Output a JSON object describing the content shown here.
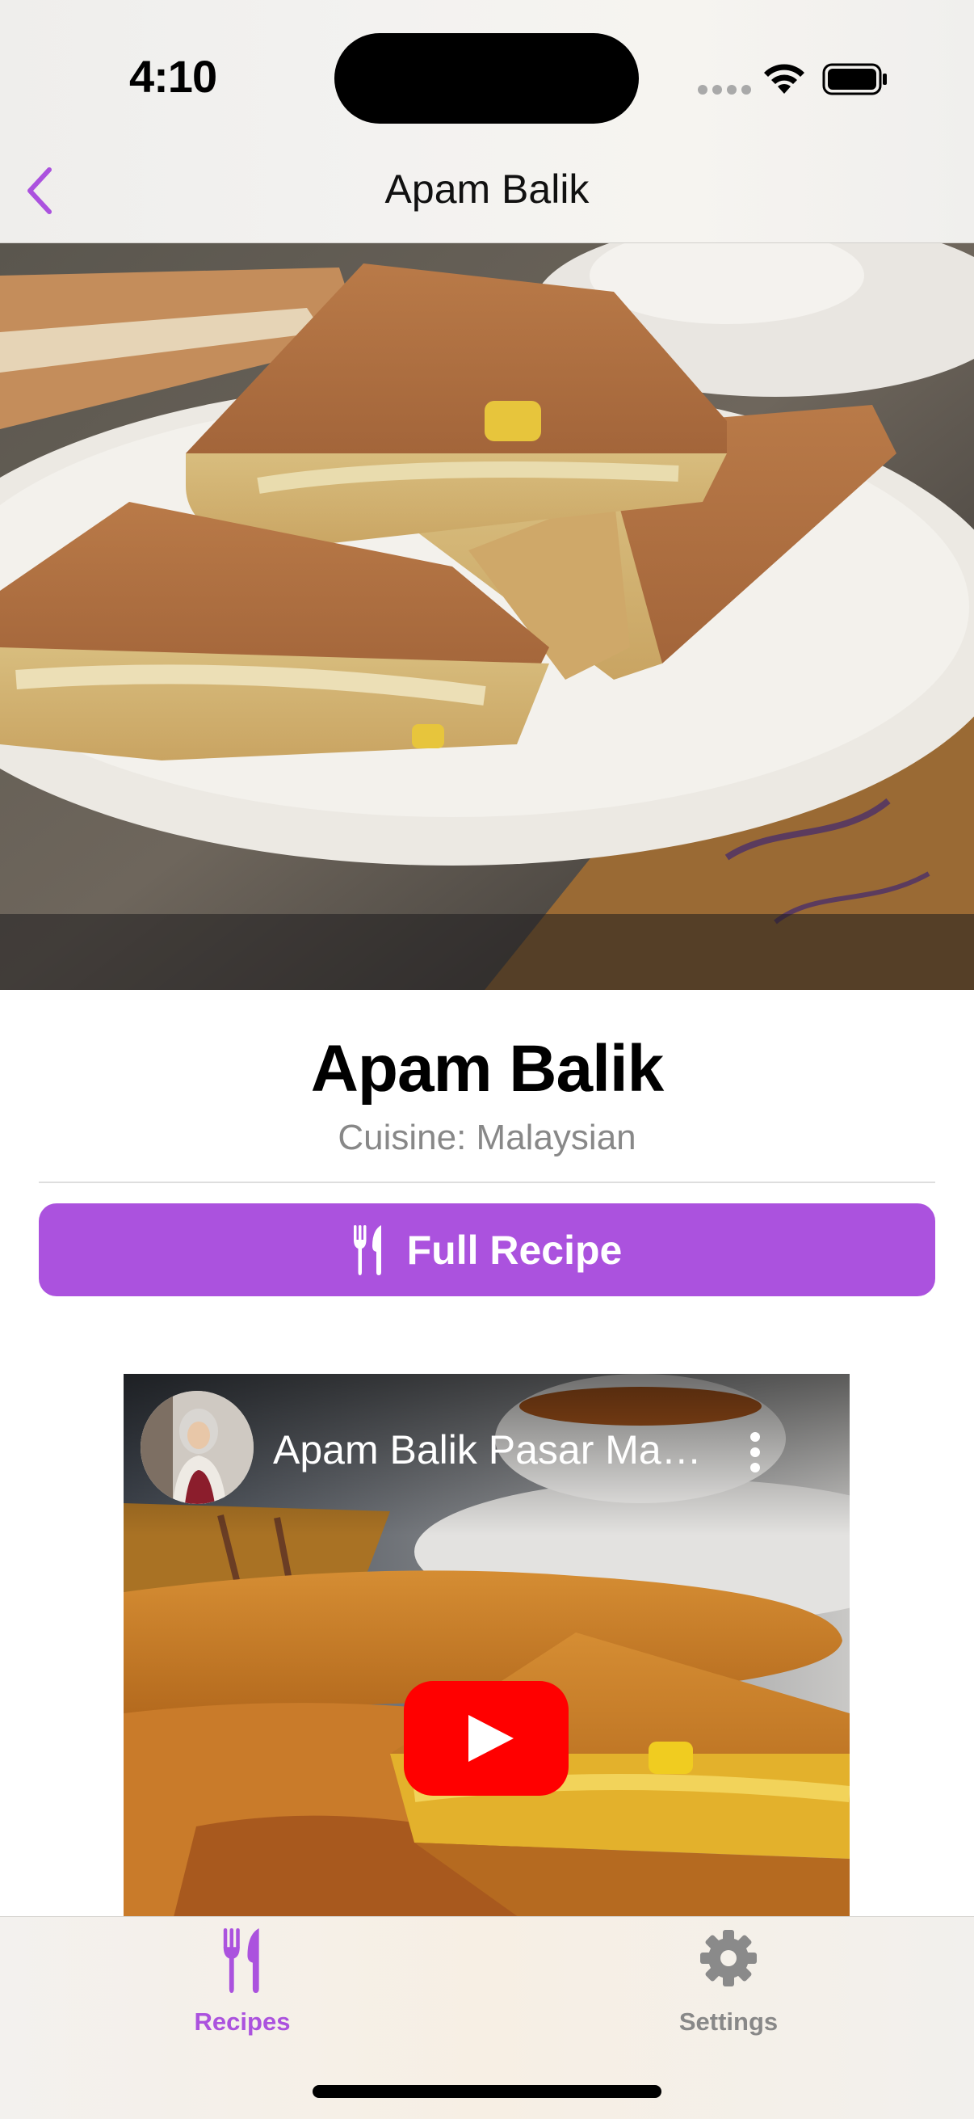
{
  "status_bar": {
    "time": "4:10"
  },
  "nav": {
    "back_icon": "chevron-left-icon",
    "title": "Apam Balik"
  },
  "recipe": {
    "name": "Apam Balik",
    "cuisine": "Cuisine: Malaysian",
    "full_recipe_label": "Full Recipe",
    "full_recipe_icon": "fork-knife-icon"
  },
  "video": {
    "title": "Apam Balik Pasar Malam",
    "more_icon": "more-vertical-icon",
    "play_icon": "youtube-play-icon"
  },
  "tabs": [
    {
      "label": "Recipes",
      "icon": "fork-knife-icon",
      "selected": true
    },
    {
      "label": "Settings",
      "icon": "gear-icon",
      "selected": false
    }
  ],
  "colors": {
    "accent": "#ab52de",
    "youtube_red": "#ff0000",
    "inactive_tab": "#888888"
  }
}
